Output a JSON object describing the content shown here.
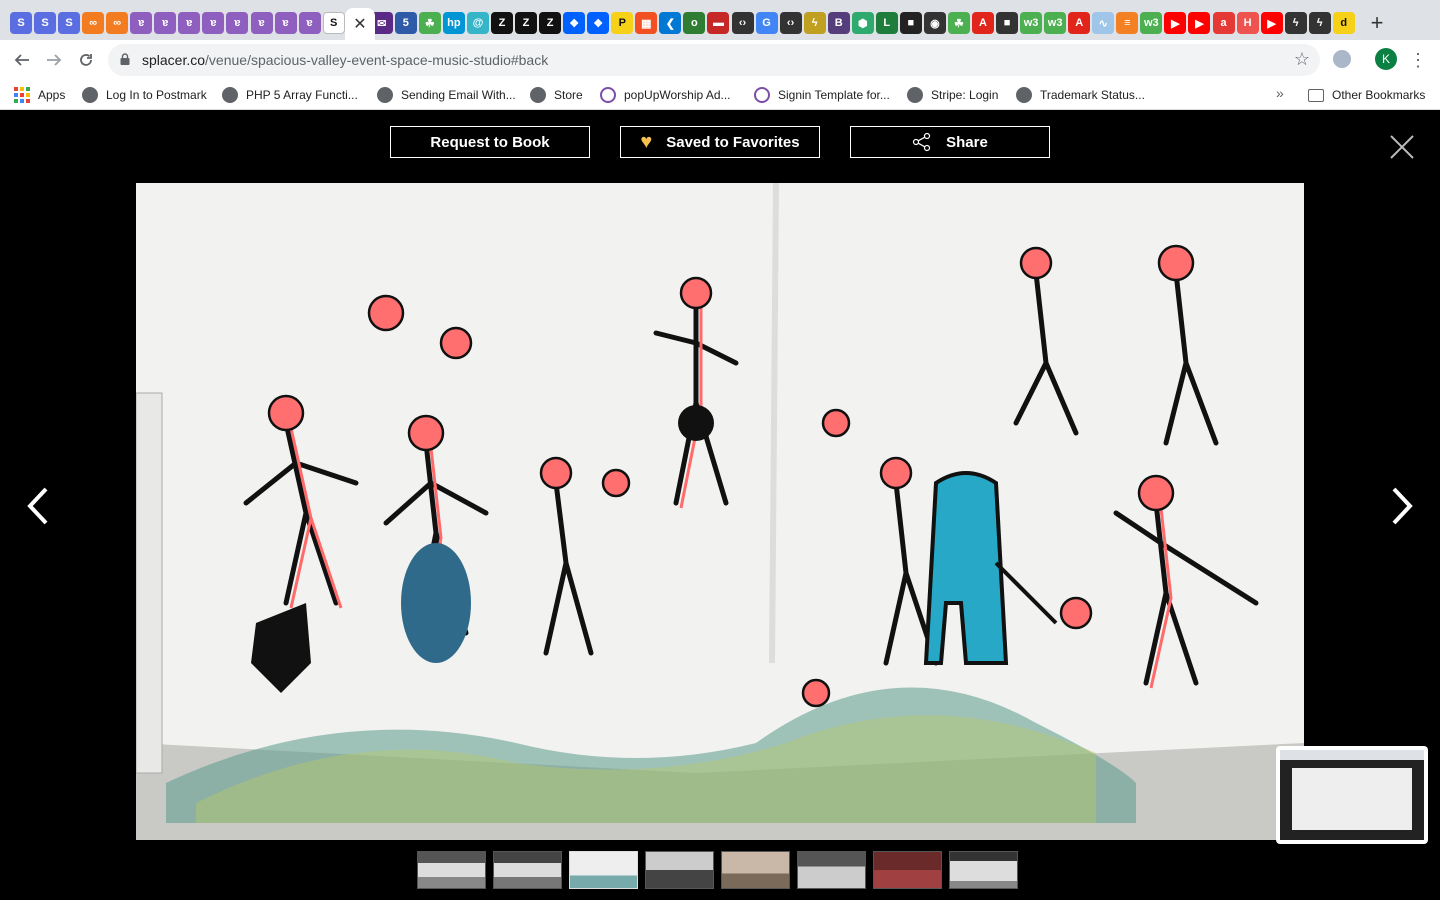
{
  "browser": {
    "tabs": [
      {
        "icon": "s-blue-icon",
        "color": "#5b6ee1",
        "glyph": "S"
      },
      {
        "icon": "s-blue-icon",
        "color": "#5b6ee1",
        "glyph": "S"
      },
      {
        "icon": "s-blue-icon",
        "color": "#5b6ee1",
        "glyph": "S"
      },
      {
        "icon": "link-orange-icon",
        "color": "#f47c20",
        "glyph": "∞"
      },
      {
        "icon": "link-orange-icon",
        "color": "#f47c20",
        "glyph": "∞"
      },
      {
        "icon": "yoga-icon",
        "color": "#8f5fbf",
        "glyph": "ɐ"
      },
      {
        "icon": "yoga-icon",
        "color": "#8f5fbf",
        "glyph": "ɐ"
      },
      {
        "icon": "yoga-icon",
        "color": "#8f5fbf",
        "glyph": "ɐ"
      },
      {
        "icon": "yoga-icon",
        "color": "#8f5fbf",
        "glyph": "ɐ"
      },
      {
        "icon": "yoga-icon",
        "color": "#8f5fbf",
        "glyph": "ɐ"
      },
      {
        "icon": "yoga-icon",
        "color": "#8f5fbf",
        "glyph": "ɐ"
      },
      {
        "icon": "yoga-icon",
        "color": "#8f5fbf",
        "glyph": "ɐ"
      },
      {
        "icon": "yoga-icon",
        "color": "#8f5fbf",
        "glyph": "ɐ"
      },
      {
        "icon": "splacer-icon",
        "color": "#ffffff",
        "glyph": "S"
      },
      {
        "icon": "mail-icon",
        "color": "#5b2a86",
        "glyph": "✉"
      },
      {
        "icon": "html5-icon",
        "color": "#2f5aa8",
        "glyph": "5"
      },
      {
        "icon": "leaf-icon",
        "color": "#4caf50",
        "glyph": "☘"
      },
      {
        "icon": "hp-icon",
        "color": "#0096d6",
        "glyph": "hp"
      },
      {
        "icon": "swirl-icon",
        "color": "#36b5c9",
        "glyph": "@"
      },
      {
        "icon": "zendesk-icon",
        "color": "#111111",
        "glyph": "Z"
      },
      {
        "icon": "zendesk-icon",
        "color": "#111111",
        "glyph": "Z"
      },
      {
        "icon": "zendesk-icon",
        "color": "#111111",
        "glyph": "Z"
      },
      {
        "icon": "dropbox-icon",
        "color": "#0061fe",
        "glyph": "❖"
      },
      {
        "icon": "dropbox-icon",
        "color": "#0061fe",
        "glyph": "❖"
      },
      {
        "icon": "p-yellow-icon",
        "color": "#f7d117",
        "glyph": "P"
      },
      {
        "icon": "microsoft-icon",
        "color": "#f25022",
        "glyph": "▦"
      },
      {
        "icon": "vscode-icon",
        "color": "#0078d4",
        "glyph": "❮"
      },
      {
        "icon": "o-green-icon",
        "color": "#2e7d32",
        "glyph": "o"
      },
      {
        "icon": "red-box-icon",
        "color": "#c62828",
        "glyph": "▬"
      },
      {
        "icon": "code-icon",
        "color": "#333333",
        "glyph": "‹›"
      },
      {
        "icon": "google-icon",
        "color": "#4285f4",
        "glyph": "G"
      },
      {
        "icon": "code-icon",
        "color": "#333333",
        "glyph": "‹›"
      },
      {
        "icon": "bolt-icon",
        "color": "#c0a020",
        "glyph": "ϟ"
      },
      {
        "icon": "bootstrap-icon",
        "color": "#563d7c",
        "glyph": "B"
      },
      {
        "icon": "hex-green-icon",
        "color": "#2eaa6e",
        "glyph": "⬢"
      },
      {
        "icon": "l-green-icon",
        "color": "#1e7d3a",
        "glyph": "L"
      },
      {
        "icon": "dark-square-icon",
        "color": "#222222",
        "glyph": "■"
      },
      {
        "icon": "dark-square-icon",
        "color": "#333333",
        "glyph": "◉"
      },
      {
        "icon": "leaf-icon",
        "color": "#4caf50",
        "glyph": "☘"
      },
      {
        "icon": "adobe-icon",
        "color": "#e1251b",
        "glyph": "A"
      },
      {
        "icon": "dark-square-icon",
        "color": "#333333",
        "glyph": "■"
      },
      {
        "icon": "w3-icon",
        "color": "#4caf50",
        "glyph": "w3"
      },
      {
        "icon": "w3-icon",
        "color": "#4caf50",
        "glyph": "w3"
      },
      {
        "icon": "adobe-icon",
        "color": "#e1251b",
        "glyph": "A"
      },
      {
        "icon": "wave-icon",
        "color": "#9fc5e8",
        "glyph": "∿"
      },
      {
        "icon": "stack-icon",
        "color": "#f48024",
        "glyph": "≡"
      },
      {
        "icon": "w3-icon",
        "color": "#4caf50",
        "glyph": "w3"
      },
      {
        "icon": "youtube-icon",
        "color": "#ff0000",
        "glyph": "▶"
      },
      {
        "icon": "youtube-icon",
        "color": "#ff0000",
        "glyph": "▶"
      },
      {
        "icon": "a-red-icon",
        "color": "#e53935",
        "glyph": "a"
      },
      {
        "icon": "h-red-icon",
        "color": "#ef5350",
        "glyph": "H"
      },
      {
        "icon": "youtube-icon",
        "color": "#ff0000",
        "glyph": "▶"
      },
      {
        "icon": "bolt-dark-icon",
        "color": "#333333",
        "glyph": "ϟ"
      },
      {
        "icon": "bolt-dark-icon",
        "color": "#333333",
        "glyph": "ϟ"
      },
      {
        "icon": "d-yellow-icon",
        "color": "#f7d117",
        "glyph": "d"
      }
    ],
    "active_tab_close": "✕",
    "new_tab": "+",
    "url_host": "splacer.co",
    "url_path": "/venue/spacious-valley-event-space-music-studio#back",
    "profile_initial": "K",
    "bookmarks": [
      {
        "label": "Apps",
        "icon": "apps-grid-icon"
      },
      {
        "label": "Log In to Postmark",
        "icon": "globe-icon"
      },
      {
        "label": "PHP 5 Array Functi...",
        "icon": "globe-icon"
      },
      {
        "label": "Sending Email With...",
        "icon": "globe-icon"
      },
      {
        "label": "Store",
        "icon": "globe-icon"
      },
      {
        "label": "popUpWorship Ad...",
        "icon": "yoga-icon"
      },
      {
        "label": "Signin Template for...",
        "icon": "yoga-icon"
      },
      {
        "label": "Stripe: Login",
        "icon": "globe-icon"
      },
      {
        "label": "Trademark Status...",
        "icon": "globe-icon"
      }
    ],
    "bookmarks_overflow": "»",
    "other_bookmarks": "Other Bookmarks"
  },
  "viewer": {
    "request_label": "Request to Book",
    "saved_label": "Saved to Favorites",
    "share_label": "Share",
    "heart_color": "#f5c050"
  }
}
